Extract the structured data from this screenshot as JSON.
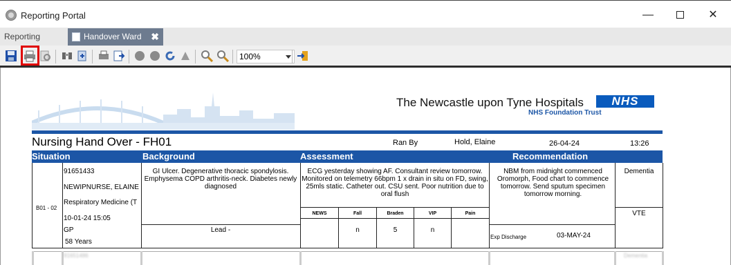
{
  "window": {
    "title": "Reporting Portal",
    "minimize": "—",
    "close": "✕"
  },
  "tabs": [
    {
      "label": "Reporting Portal"
    },
    {
      "label": "Handover Ward",
      "close": "✖"
    }
  ],
  "toolbar": {
    "zoom_value": "100%",
    "icons": [
      "save-icon",
      "print-icon",
      "print-preview-icon",
      "find-icon",
      "export-icon",
      "page-setup-icon",
      "export-pdf-icon",
      "prev-icon",
      "next-icon",
      "refresh-icon",
      "parameters-icon",
      "zoom-out-icon",
      "zoom-in-icon",
      "exit-icon"
    ]
  },
  "report": {
    "trust_name": "The Newcastle upon Tyne Hospitals",
    "trust_sub": "NHS Foundation Trust",
    "nhs_logo": "NHS",
    "title": "Nursing Hand Over - FH01",
    "ran_by_label": "Ran By",
    "ran_by_name": "Hold, Elaine",
    "date": "26-04-24",
    "time": "13:26",
    "columns": {
      "situation": "Situation",
      "background": "Background",
      "assessment": "Assessment",
      "recommendation": "Recommendation"
    },
    "patient": {
      "bed": "B01 - 02",
      "id": "91651433",
      "name": "NEWIPNURSE, ELAINE",
      "specialty": "Respiratory Medicine (T",
      "admitted": "10-01-24 15:05",
      "gp": "GP",
      "age": "58 Years",
      "background": "GI Ulcer. Degenerative thoracic spondylosis. Emphysema COPD arthritis-neck. Diabetes newly diagnosed",
      "lead": "Lead -",
      "assessment": "ECG yesterday showing AF. Consultant review tomorrow. Monitored on telemetry 66bpm 1 x drain in situ on FD, swing, 25mls static. Catheter out. CSU sent. Poor nutrition due to oral flush",
      "scores_headers": [
        "NEWS",
        "Fall",
        "Braden",
        "VIP",
        "Pain"
      ],
      "scores_values": [
        "",
        "n",
        "5",
        "n",
        ""
      ],
      "recommendation": "NBM from midnight commenced Oromorph, Food chart to commence tomorrow. Send sputum specimen tomorrow morning.",
      "exp_discharge_label": "Exp Discharge",
      "exp_discharge": "03-MAY-24",
      "dementia": "Dementia",
      "vte": "VTE"
    },
    "next_row": {
      "id": "91651486",
      "flag": "Dementia"
    }
  }
}
